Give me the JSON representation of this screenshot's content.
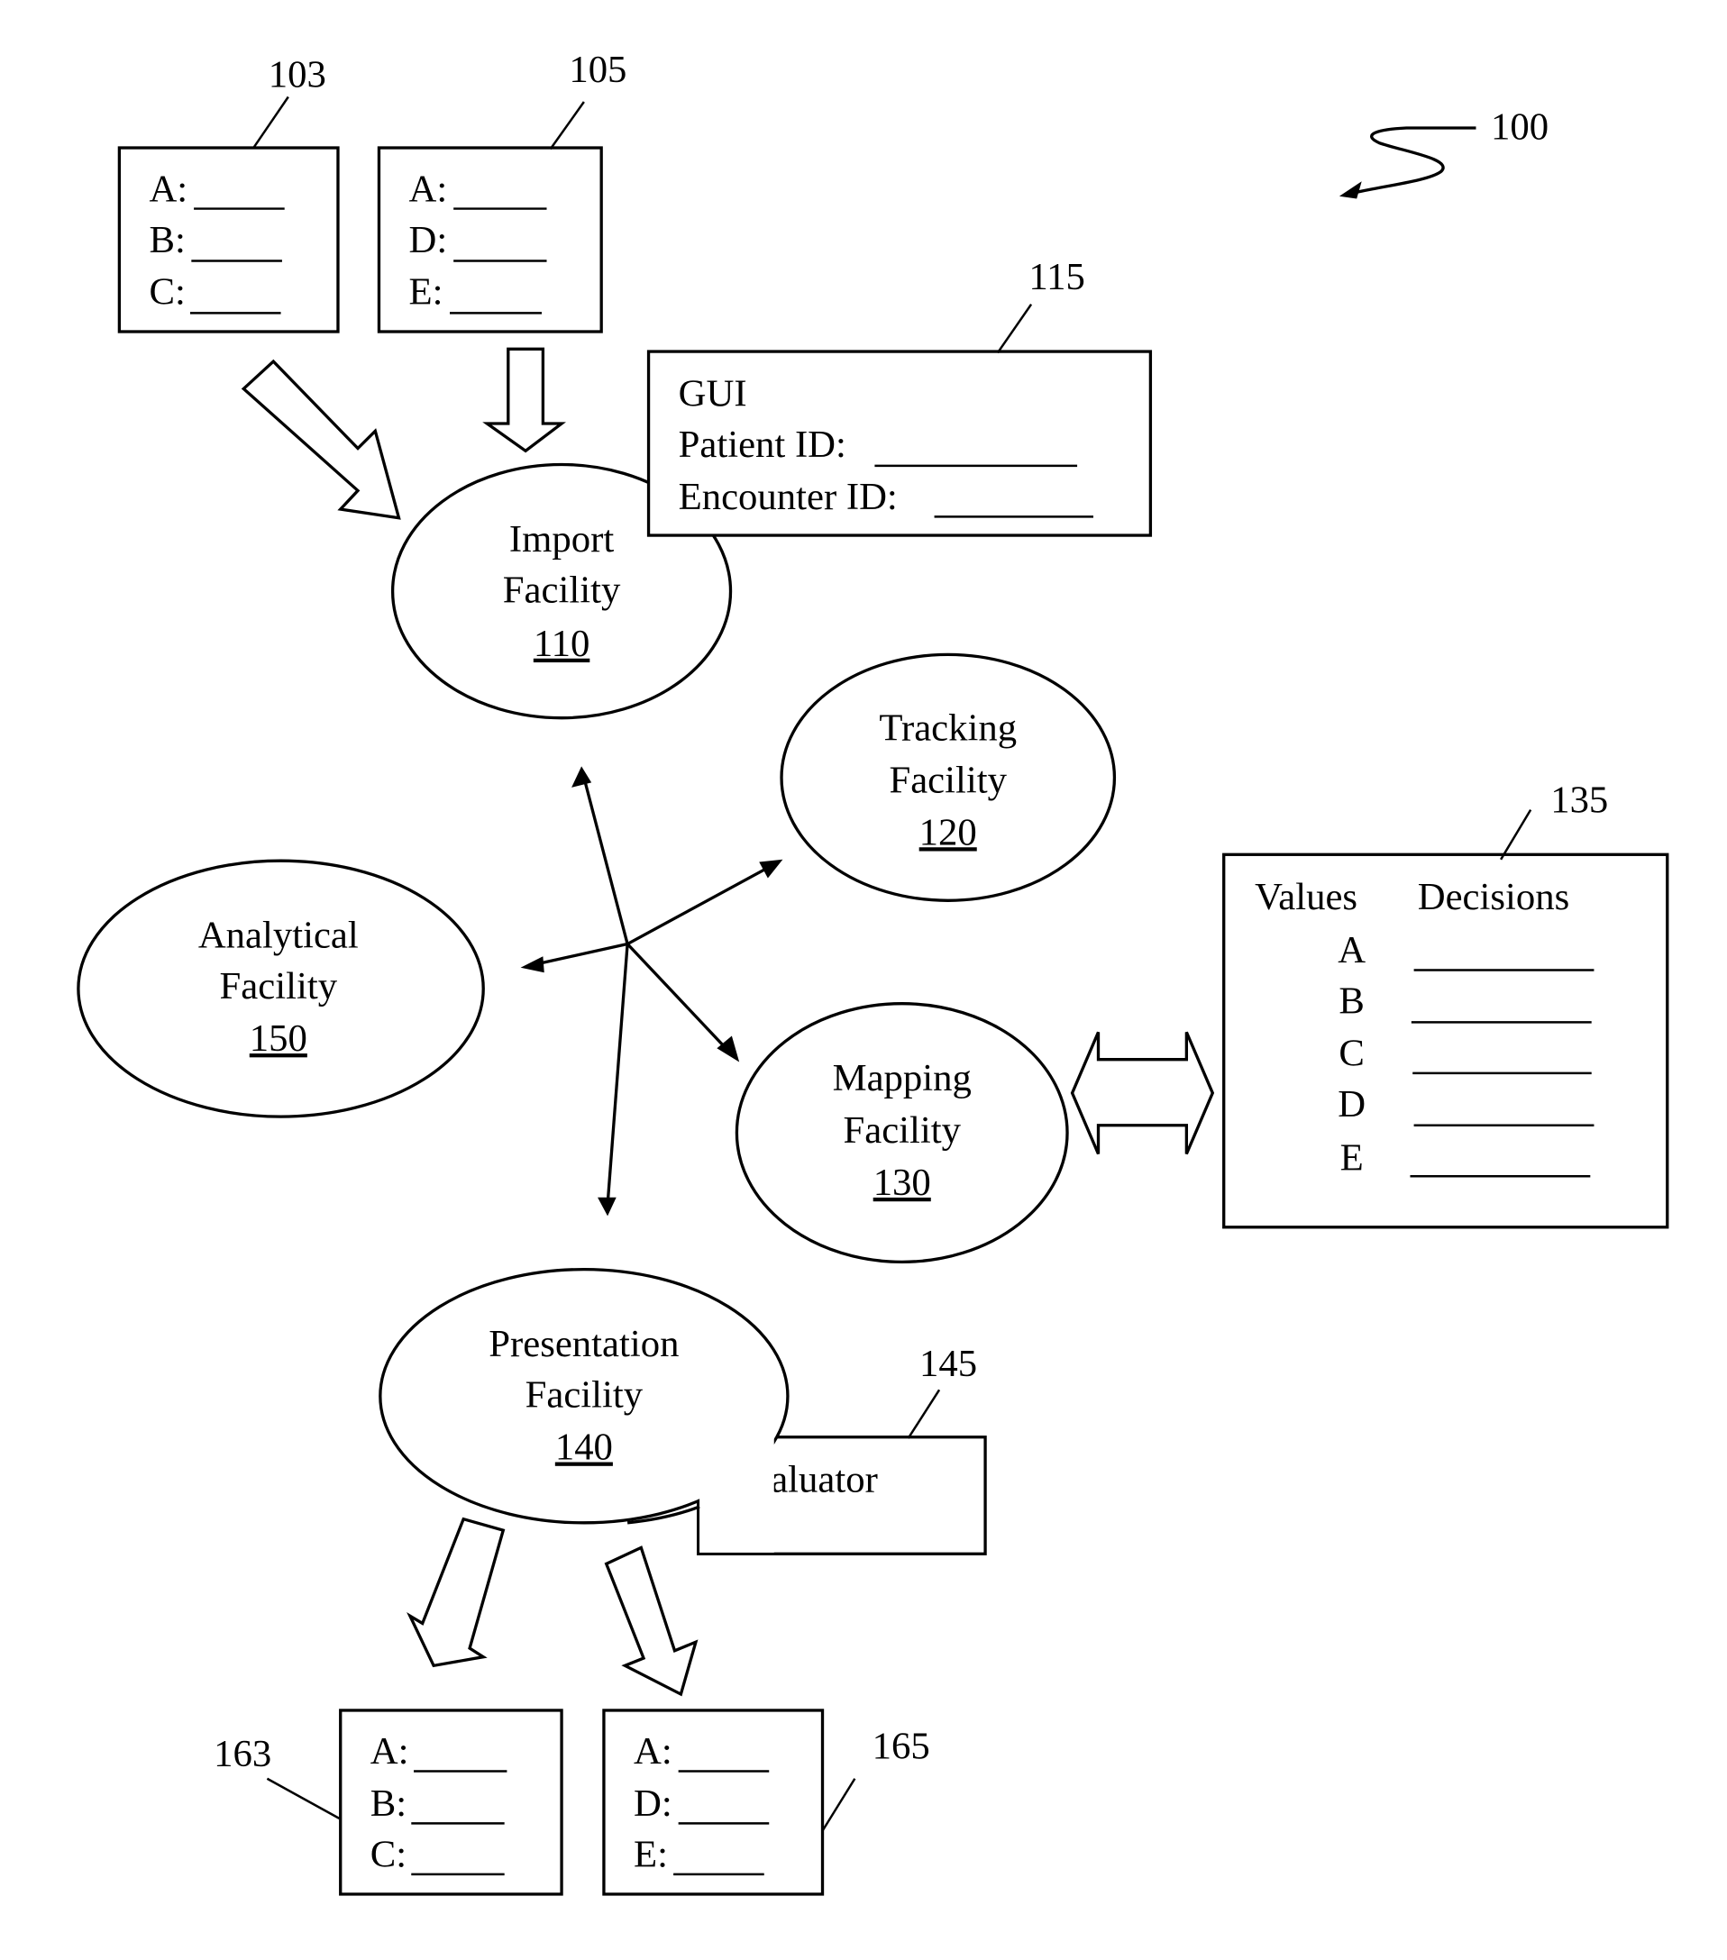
{
  "figure": {
    "ref": "100"
  },
  "forms": [
    {
      "ref": "103",
      "fields": [
        "A:",
        "B:",
        "C:"
      ]
    },
    {
      "ref": "105",
      "fields": [
        "A:",
        "D:",
        "E:"
      ]
    },
    {
      "ref": "163",
      "fields": [
        "A:",
        "B:",
        "C:"
      ]
    },
    {
      "ref": "165",
      "fields": [
        "A:",
        "D:",
        "E:"
      ]
    }
  ],
  "gui": {
    "ref": "115",
    "title": "GUI",
    "fields": [
      "Patient ID:",
      "Encounter ID:"
    ]
  },
  "facilities": {
    "import": {
      "line1": "Import",
      "line2": "Facility",
      "ref": "110"
    },
    "tracking": {
      "line1": "Tracking",
      "line2": "Facility",
      "ref": "120"
    },
    "mapping": {
      "line1": "Mapping",
      "line2": "Facility",
      "ref": "130"
    },
    "presentation": {
      "line1": "Presentation",
      "line2": "Facility",
      "ref": "140"
    },
    "analytical": {
      "line1": "Analytical",
      "line2": "Facility",
      "ref": "150"
    }
  },
  "table": {
    "ref": "135",
    "headers": [
      "Values",
      "Decisions"
    ],
    "rows": [
      "A",
      "B",
      "C",
      "D",
      "E"
    ]
  },
  "evaluator": {
    "ref": "145",
    "label": "Evaluator"
  }
}
